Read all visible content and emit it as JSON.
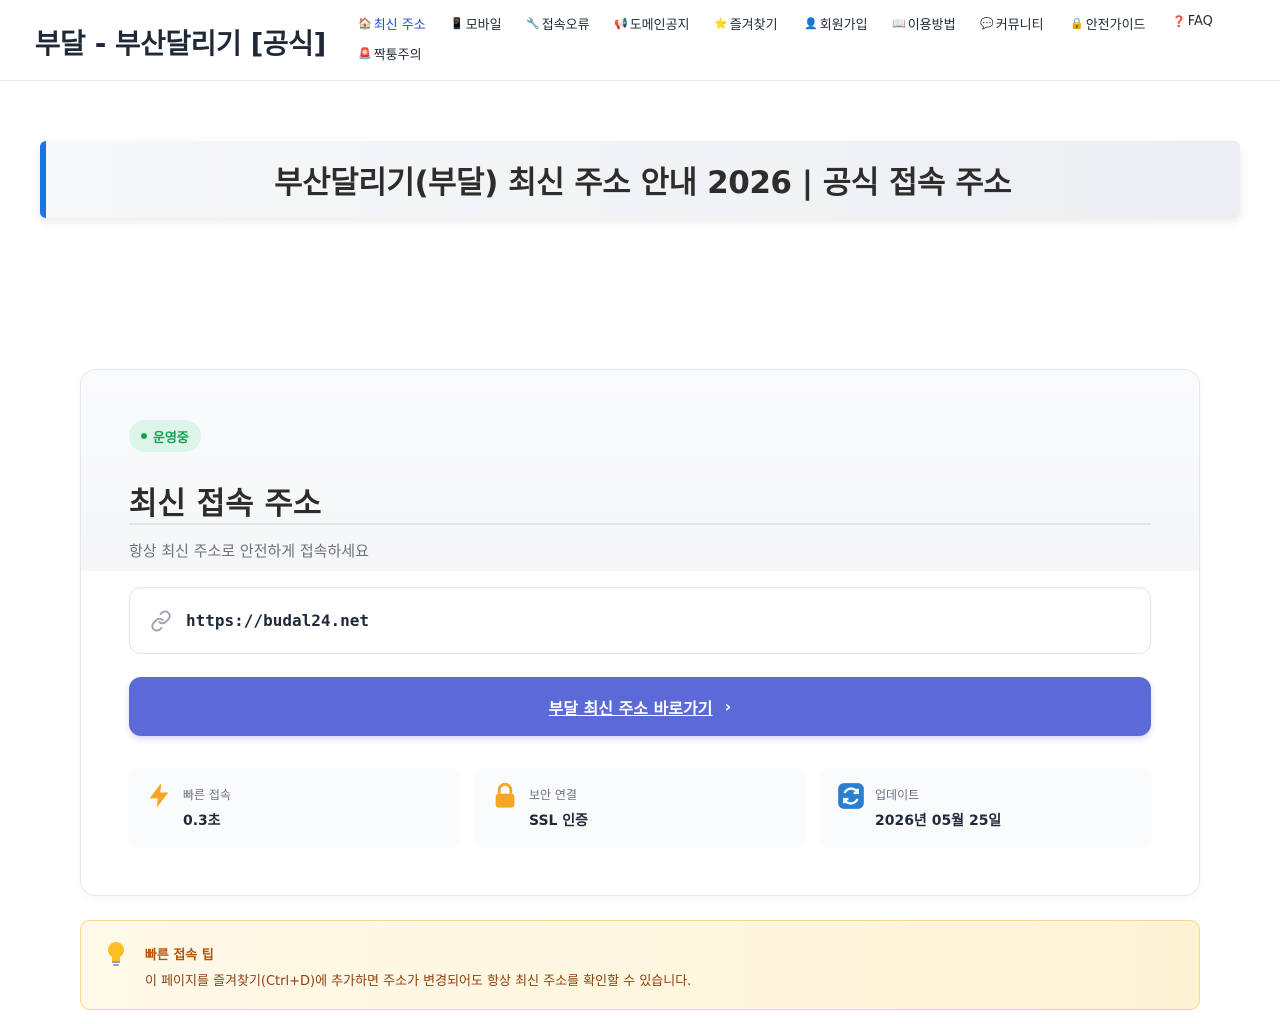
{
  "header": {
    "brand": "부달 - 부산달리기 [공식]",
    "nav": [
      {
        "icon": "🏠",
        "label": "최신 주소"
      },
      {
        "icon": "📱",
        "label": "모바일"
      },
      {
        "icon": "🔧",
        "label": "접속오류"
      },
      {
        "icon": "📢",
        "label": "도메인공지"
      },
      {
        "icon": "⭐",
        "label": "즐겨찾기"
      },
      {
        "icon": "👤",
        "label": "회원가입"
      },
      {
        "icon": "📖",
        "label": "이용방법"
      },
      {
        "icon": "💬",
        "label": "커뮤니티"
      },
      {
        "icon": "🔒",
        "label": "안전가이드"
      },
      {
        "icon": "❓",
        "label": "FAQ"
      },
      {
        "icon": "🚨",
        "label": "짝퉁주의"
      }
    ]
  },
  "banner": {
    "title": "부산달리기(부달) 최신 주소 안내 2026 | 공식 접속 주소"
  },
  "card": {
    "status": "운영중",
    "title": "최신 접속 주소",
    "subtitle": "항상 최신 주소로 안전하게 접속하세요",
    "url": "https://budal24.net",
    "button_label": "부달 최신 주소 바로가기",
    "features": [
      {
        "icon": "lightning-icon",
        "label": "빠른 접속",
        "value": "0.3초"
      },
      {
        "icon": "lock-icon",
        "label": "보안 연결",
        "value": "SSL 인증"
      },
      {
        "icon": "refresh-icon",
        "label": "업데이트",
        "value": "2026년 05월 25일"
      }
    ]
  },
  "tip": {
    "title": "빠른 접속 팁",
    "text": "이 페이지를 즐겨찾기(Ctrl+D)에 추가하면 주소가 변경되어도 항상 최신 주소를 확인할 수 있습니다."
  },
  "colors": {
    "accent": "#1a73e8",
    "button": "#5b6ad6",
    "status": "#15a35a",
    "tip_title": "#b45309"
  }
}
